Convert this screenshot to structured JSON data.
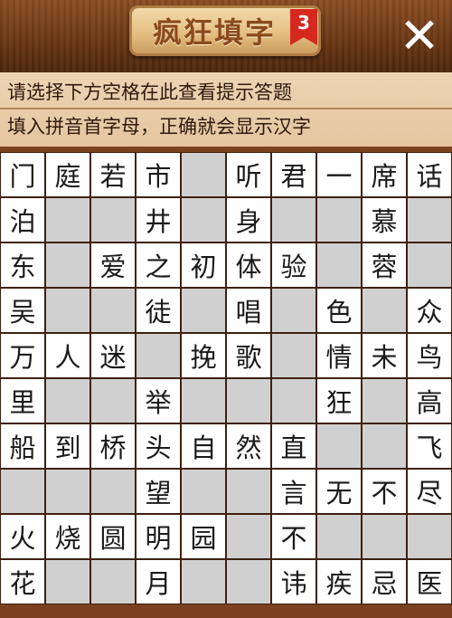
{
  "header": {
    "title": "疯狂填字",
    "level": "3",
    "close_symbol": "✕"
  },
  "hint": {
    "line1": "请选择下方空格在此查看提示答题",
    "line2": "填入拼音首字母，正确就会显示汉字"
  },
  "grid": {
    "rows": [
      [
        "门",
        "庭",
        "若",
        "市",
        "",
        "听",
        "君",
        "一",
        "席",
        "话"
      ],
      [
        "泊",
        "",
        "",
        "井",
        "",
        "身",
        "",
        "",
        "慕",
        ""
      ],
      [
        "东",
        "",
        "爱",
        "之",
        "初",
        "体",
        "验",
        "",
        "蓉",
        ""
      ],
      [
        "吴",
        "",
        "",
        "徒",
        "",
        "唱",
        "",
        "色",
        "",
        "众"
      ],
      [
        "万",
        "人",
        "迷",
        "",
        "挽",
        "歌",
        "",
        "情",
        "未",
        "鸟"
      ],
      [
        "里",
        "",
        "",
        "举",
        "",
        "",
        "",
        "狂",
        "",
        "高"
      ],
      [
        "船",
        "到",
        "桥",
        "头",
        "自",
        "然",
        "直",
        "",
        "",
        "飞"
      ],
      [
        "",
        "",
        "",
        "望",
        "",
        "",
        "言",
        "无",
        "不",
        "尽"
      ],
      [
        "火",
        "烧",
        "圆",
        "明",
        "园",
        "",
        "不",
        "",
        "",
        ""
      ],
      [
        "花",
        "",
        "",
        "月",
        "",
        "",
        "讳",
        "疾",
        "忌",
        "医"
      ]
    ]
  },
  "colors": {
    "wood_dark": "#6b3815",
    "hint_bg": "#e8cda9",
    "cell_filled": "#ffffff",
    "cell_empty": "#d0d0d0",
    "ribbon": "#d6281f"
  }
}
